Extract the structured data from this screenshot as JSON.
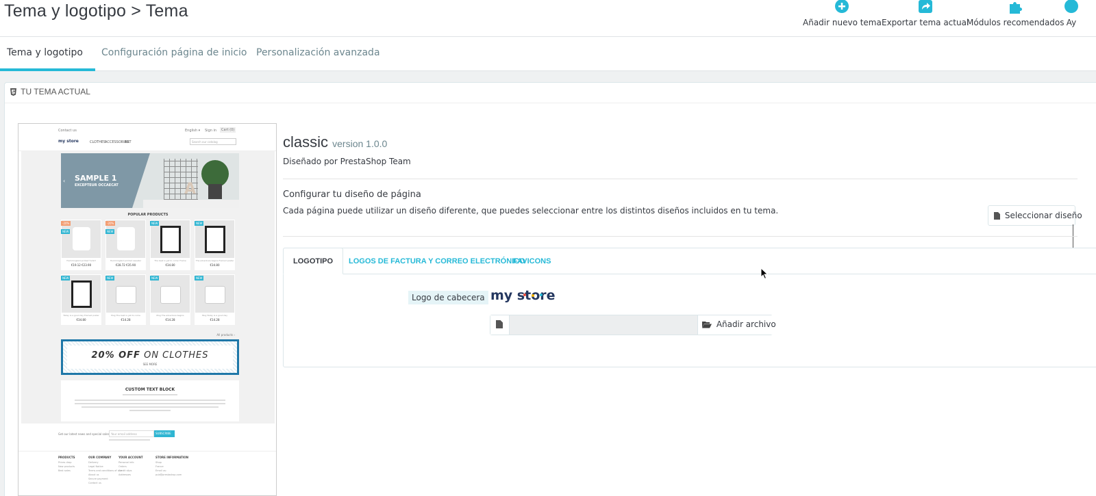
{
  "header": {
    "title": "Tema y logotipo > Tema",
    "toolbar": [
      {
        "label": "Añadir nuevo tema",
        "icon": "add-circle-icon"
      },
      {
        "label": "Exportar tema actual",
        "icon": "export-share-icon"
      },
      {
        "label": "Módulos recomendados",
        "icon": "puzzle-icon"
      },
      {
        "label": "Ay",
        "icon": "help-icon"
      }
    ]
  },
  "tabs": [
    {
      "label": "Tema y logotipo",
      "active": true
    },
    {
      "label": "Configuración página de inicio",
      "active": false
    },
    {
      "label": "Personalización avanzada",
      "active": false
    }
  ],
  "panel": {
    "heading": "TU TEMA ACTUAL"
  },
  "preview": {
    "top_left": "Contact us",
    "top_lang": "English ▾",
    "top_signin": "Sign in",
    "top_cart": "Cart (0)",
    "brand": "my store",
    "nav": [
      "CLOTHES",
      "ACCESSORIES",
      "ART"
    ],
    "search_placeholder": "Search our catalog",
    "hero_title": "SAMPLE 1",
    "hero_subtitle": "EXCEPTEUR OCCAECAT",
    "popular": "POPULAR PRODUCTS",
    "products": [
      {
        "name": "Hummingbird printed T-shirt",
        "price": "€19.12 €23.90",
        "badge": "-20%",
        "type": "shirt"
      },
      {
        "name": "Hummingbird printed sweater",
        "price": "€28.72 €35.90",
        "badge": "-20%",
        "type": "shirt"
      },
      {
        "name": "The best is yet to come' Frame",
        "price": "€34.80",
        "badge": "NEW",
        "type": "frame"
      },
      {
        "name": "The adventure begins Framed poster",
        "price": "€34.80",
        "badge": "NEW",
        "type": "frame"
      },
      {
        "name": "Today is a good day Framed poster",
        "price": "€34.80",
        "badge": "NEW",
        "type": "frame"
      },
      {
        "name": "Mug The best is yet to come",
        "price": "€14.28",
        "badge": "NEW",
        "type": "mug"
      },
      {
        "name": "Mug The adventure begins",
        "price": "€14.28",
        "badge": "NEW",
        "type": "mug"
      },
      {
        "name": "Mug Today is a good day",
        "price": "€14.28",
        "badge": "NEW",
        "type": "mug"
      }
    ],
    "all_products": "All products ›",
    "promo_strong": "20% OFF",
    "promo_rest": " ON CLOTHES",
    "promo_more": "SEE MORE",
    "custom_title": "CUSTOM TEXT BLOCK",
    "newsletter_label": "Get our latest news and special sales",
    "newsletter_placeholder": "Your email address",
    "newsletter_button": "SUBSCRIBE",
    "footer_cols": [
      {
        "title": "PRODUCTS",
        "items": [
          "Prices drop",
          "New products",
          "Best sales"
        ]
      },
      {
        "title": "OUR COMPANY",
        "items": [
          "Delivery",
          "Legal Notice",
          "Terms and conditions of use",
          "About us",
          "Secure payment",
          "Contact us"
        ]
      },
      {
        "title": "YOUR ACCOUNT",
        "items": [
          "Personal info",
          "Orders",
          "Credit slips",
          "Addresses"
        ]
      },
      {
        "title": "STORE INFORMATION",
        "items": [
          "Shop",
          "France",
          "Email us:",
          "pub@prestashop.com"
        ]
      }
    ]
  },
  "theme": {
    "name": "classic",
    "version": "version 1.0.0",
    "author": "Diseñado por PrestaShop Team",
    "layout_title": "Configurar tu diseño de página",
    "layout_desc": "Cada página puede utilizar un diseño diferente, que puedes seleccionar entre los distintos diseños incluidos en tu tema.",
    "select_button": "Seleccionar diseño"
  },
  "logo_tabs": [
    {
      "label": "LOGOTIPO",
      "active": true
    },
    {
      "label": "LOGOS DE FACTURA Y CORREO ELECTRÓNICO",
      "active": false
    },
    {
      "label": "FAVICONS",
      "active": false
    }
  ],
  "logo": {
    "label": "Logo de cabecera",
    "brand_text": "my store",
    "add_file_button": "Añadir archivo"
  },
  "colors": {
    "accent": "#25b9d7",
    "text": "#363a41",
    "muted": "#6c868e"
  }
}
